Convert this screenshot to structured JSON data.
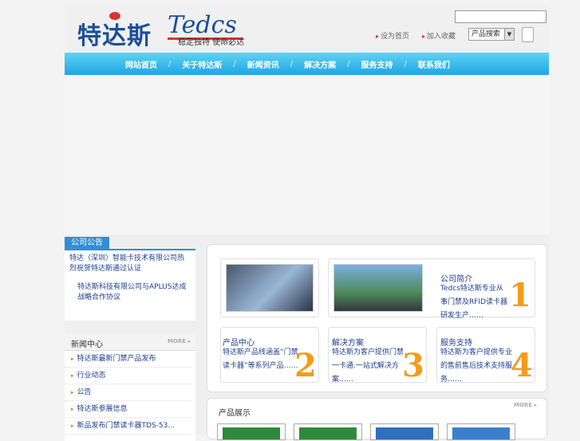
{
  "logo": {
    "cn": "特达斯",
    "en": "Tedcs",
    "slogan": "稳定独特 使命必达"
  },
  "top_links": [
    "设为首页",
    "加入收藏"
  ],
  "search": {
    "select_value": "产品搜索"
  },
  "nav": [
    "网站首页",
    "关于特达斯",
    "新闻资讯",
    "解决方案",
    "服务支持",
    "联系我们"
  ],
  "notice": {
    "tab": "公司公告",
    "text1": "特达（深圳）智能卡技术有限公司热烈祝贺特达斯通过认证",
    "text2": "特达斯科技有限公司与APLUS达成战略合作协议"
  },
  "news": {
    "title": "新闻中心",
    "more": "MORE",
    "items": [
      "特达斯最新门禁产品发布",
      "行业动态",
      "公告",
      "特达斯参展信息",
      "新品发布门禁读卡器TDS-53..."
    ]
  },
  "features": [
    {
      "title": "公司简介",
      "text": "Tedcs特达斯专业从事门禁及RFID读卡器研发生产……",
      "num": "1"
    },
    {
      "title": "产品中心",
      "text": "特达斯产品线涵盖“门禁读卡器”等系列产品……",
      "num": "2"
    },
    {
      "title": "解决方案",
      "text": "特达斯为客户提供门禁一卡通.一站式解决方案……",
      "num": "3"
    },
    {
      "title": "服务支持",
      "text": "特达斯为客户提供专业的售前售后技术支持服务……",
      "num": "4"
    }
  ],
  "products": {
    "title": "产品展示",
    "more": "MORE"
  },
  "colors": {
    "nav_top": "#5fd2f5",
    "nav_bottom": "#1ea7e2",
    "brand_blue": "#1c4f9a",
    "accent_orange": "#f39c1a",
    "tab_blue": "#2f8fd8"
  }
}
